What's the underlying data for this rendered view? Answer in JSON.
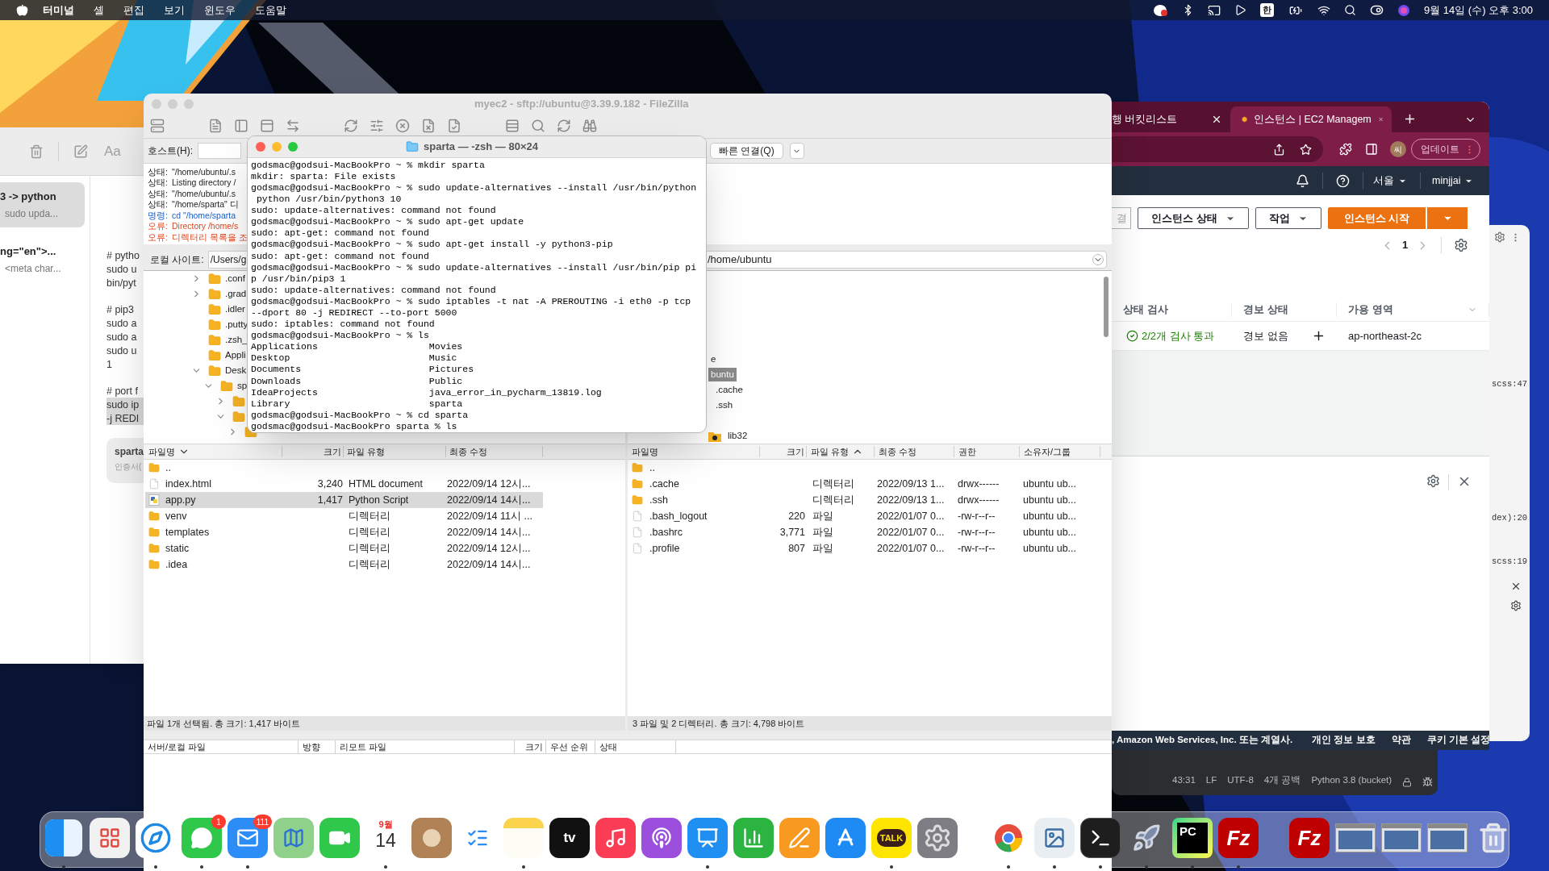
{
  "menu_bar": {
    "app": "터미널",
    "menus": [
      "셸",
      "편집",
      "보기",
      "윈도우",
      "도움말"
    ],
    "input_source": "한",
    "clock": "9월 14일 (수) 오후 3:00"
  },
  "notes_window": {
    "toolbar_text": "Aa",
    "notes": [
      {
        "title": "3 -> python",
        "preview": "sudo upda...",
        "selected": true
      },
      {
        "title": "ng=\"en\">...",
        "preview": "<meta char...",
        "selected": false
      }
    ],
    "paragraphs": [
      {
        "lines": [
          {
            "text": "# pytho",
            "highlighted": false
          },
          {
            "text": "sudo u",
            "highlighted": false
          },
          {
            "text": "bin/pyt",
            "highlighted": false
          }
        ]
      },
      {
        "lines": [
          {
            "text": "# pip3",
            "highlighted": false
          },
          {
            "text": "sudo a",
            "highlighted": false
          },
          {
            "text": "sudo a",
            "highlighted": false
          },
          {
            "text": "sudo u",
            "highlighted": false
          },
          {
            "text": "1",
            "highlighted": false
          }
        ]
      },
      {
        "lines": [
          {
            "text": "# port f",
            "highlighted": false
          },
          {
            "text": "sudo ip",
            "highlighted": true
          },
          {
            "text": "-j REDI",
            "highlighted": true
          }
        ]
      }
    ],
    "attachment": {
      "title": "sparta",
      "subtitle": "인증서("
    }
  },
  "filezilla": {
    "title": "myec2 - sftp://ubuntu@3.39.9.182 - FileZilla",
    "host_label": "호스트(H):",
    "quickconnect": "빠른 연결(Q)",
    "log": [
      {
        "kind": "status",
        "label": "상태:",
        "text": "\"/home/ubuntu/.s"
      },
      {
        "kind": "status",
        "label": "상태:",
        "text": "Listing directory /"
      },
      {
        "kind": "status",
        "label": "상태:",
        "text": "\"/home/ubuntu/.s"
      },
      {
        "kind": "status",
        "label": "상태:",
        "text": "\"/home/sparta\" 디"
      },
      {
        "kind": "command",
        "label": "명령:",
        "text": "cd \"/home/sparta"
      },
      {
        "kind": "error",
        "label": "오류:",
        "text": "Directory /home/s"
      },
      {
        "kind": "error",
        "label": "오류:",
        "text": "디렉터리 목록을 조"
      }
    ],
    "local": {
      "label": "로컬 사이트:",
      "path": "/Users/g",
      "tree": [
        {
          "label": ".conf",
          "expanded": false
        },
        {
          "label": ".grad",
          "expanded": false
        },
        {
          "label": ".idler"
        },
        {
          "label": ".putty"
        },
        {
          "label": ".zsh_"
        },
        {
          "label": "Appli"
        },
        {
          "label": "Desk",
          "expanded": true,
          "children": [
            {
              "label": "sp",
              "expanded": true,
              "children": [
                {
                  "expanded": false
                },
                {
                  "expanded": true,
                  "children": [
                    {
                      "expanded": false
                    }
                  ]
                }
              ]
            }
          ]
        }
      ],
      "columns": [
        {
          "label": "파일명",
          "kind": "sort_desc"
        },
        {
          "label": "크기",
          "kind": "plain"
        },
        {
          "label": "파일 유형",
          "kind": "plain"
        },
        {
          "label": "최종 수정",
          "kind": "plain"
        }
      ],
      "rows": [
        {
          "kind": "parent",
          "name": "..",
          "selected": false
        },
        {
          "kind": "file",
          "name": "index.html",
          "size": "3,240",
          "type": "HTML document",
          "modified": "2022/09/14 12시...",
          "selected": false
        },
        {
          "kind": "python",
          "name": "app.py",
          "size": "1,417",
          "type": "Python Script",
          "modified": "2022/09/14 14시...",
          "selected": true
        },
        {
          "kind": "folder",
          "name": "venv",
          "type": "디렉터리",
          "modified": "2022/09/14 11시 ...",
          "selected": false
        },
        {
          "kind": "folder",
          "name": "templates",
          "type": "디렉터리",
          "modified": "2022/09/14 14시...",
          "selected": false
        },
        {
          "kind": "folder",
          "name": "static",
          "type": "디렉터리",
          "modified": "2022/09/14 12시...",
          "selected": false
        },
        {
          "kind": "folder",
          "name": ".idea",
          "type": "디렉터리",
          "modified": "2022/09/14 14시...",
          "selected": false
        }
      ],
      "status": "파일 1개 선택됨. 총 크기: 1,417 바이트"
    },
    "remote": {
      "path": "/home/ubuntu",
      "tree": [
        {
          "label": "e",
          "selected": false
        },
        {
          "label": "buntu",
          "selected": true,
          "children": [
            {
              "label": ".cache",
              "selected": false
            },
            {
              "label": ".ssh",
              "selected": false
            }
          ]
        },
        {
          "label": "lib32",
          "kind": "unknown_folder",
          "selected": false
        }
      ],
      "columns": [
        {
          "label": "파일명",
          "kind": "plain"
        },
        {
          "label": "크기",
          "kind": "plain"
        },
        {
          "label": "파일 유형",
          "kind": "sort_asc"
        },
        {
          "label": "최종 수정",
          "kind": "plain"
        },
        {
          "label": "권한",
          "kind": "plain"
        },
        {
          "label": "소유자/그룹",
          "kind": "plain"
        }
      ],
      "rows": [
        {
          "kind": "parent",
          "name": "..",
          "selected": false
        },
        {
          "kind": "folder",
          "name": ".cache",
          "type": "디렉터리",
          "modified": "2022/09/13 1...",
          "permissions": "drwx------",
          "owner": "ubuntu ub...",
          "selected": false
        },
        {
          "kind": "folder",
          "name": ".ssh",
          "type": "디렉터리",
          "modified": "2022/09/13 1...",
          "permissions": "drwx------",
          "owner": "ubuntu ub...",
          "selected": false
        },
        {
          "kind": "file",
          "name": ".bash_logout",
          "size": "220",
          "type": "파일",
          "modified": "2022/01/07 0...",
          "permissions": "-rw-r--r--",
          "owner": "ubuntu ub...",
          "selected": false
        },
        {
          "kind": "file",
          "name": ".bashrc",
          "size": "3,771",
          "type": "파일",
          "modified": "2022/01/07 0...",
          "permissions": "-rw-r--r--",
          "owner": "ubuntu ub...",
          "selected": false
        },
        {
          "kind": "file",
          "name": ".profile",
          "size": "807",
          "type": "파일",
          "modified": "2022/01/07 0...",
          "permissions": "-rw-r--r--",
          "owner": "ubuntu ub...",
          "selected": false
        }
      ],
      "status": "3 파일 및 2 디렉터리. 총 크기: 4,798 바이트"
    },
    "queue_columns": [
      "서버/로컬 파일",
      "방향",
      "리모트 파일",
      "크기",
      "우선 순위",
      "상태"
    ]
  },
  "terminal": {
    "title": "sparta — -zsh — 80×24",
    "lines": [
      "godsmac@godsui-MacBookPro ~ % mkdir sparta",
      "mkdir: sparta: File exists",
      "godsmac@godsui-MacBookPro ~ % sudo update-alternatives --install /usr/bin/python",
      " python /usr/bin/python3 10",
      "sudo: update-alternatives: command not found",
      "godsmac@godsui-MacBookPro ~ % sudo apt-get update",
      "sudo: apt-get: command not found",
      "godsmac@godsui-MacBookPro ~ % sudo apt-get install -y python3-pip",
      "sudo: apt-get: command not found",
      "godsmac@godsui-MacBookPro ~ % sudo update-alternatives --install /usr/bin/pip pi",
      "p /usr/bin/pip3 1",
      "sudo: update-alternatives: command not found",
      "godsmac@godsui-MacBookPro ~ % sudo iptables -t nat -A PREROUTING -i eth0 -p tcp",
      "--dport 80 -j REDIRECT --to-port 5000",
      "sudo: iptables: command not found",
      "godsmac@godsui-MacBookPro ~ % ls",
      "Applications                    Movies",
      "Desktop                         Music",
      "Documents                       Pictures",
      "Downloads                       Public",
      "IdeaProjects                    java_error_in_pycharm_13819.log",
      "Library                         sparta",
      "godsmac@godsui-MacBookPro ~ % cd sparta",
      "godsmac@godsui-MacBookPro sparta % ls"
    ]
  },
  "browser": {
    "tabs": [
      {
        "title": "행 버킷리스트",
        "selected": false
      },
      {
        "title": "인스턴스 | EC2 Managem",
        "selected": true
      }
    ],
    "update_button": "업데이트",
    "avatar": "씨",
    "console": {
      "region": "서울",
      "user": "minjjai",
      "buttons": [
        {
          "label": "결",
          "kind": "plain"
        },
        {
          "label": "인스턴스 상태",
          "kind": "dropdown"
        },
        {
          "label": "작업",
          "kind": "dropdown"
        },
        {
          "label": "인스턴스 시작",
          "kind": "primary"
        },
        {
          "kind": "primary_caret"
        }
      ],
      "page": "1",
      "columns": [
        "상태 검사",
        "경보 상태",
        "가용 영역"
      ],
      "row": {
        "status_check": "2/2개 검사 통과",
        "alarm": "경보 없음",
        "zone": "ap-northeast-2c"
      },
      "footer": [
        ", Amazon Web Services, Inc. 또는 계열사.",
        "개인 정보 보호",
        "약관",
        "쿠키 기본 설정"
      ]
    }
  },
  "editor_window": {
    "fragments": [
      "scss:47",
      "dex):20",
      "scss:19"
    ],
    "status_bar": [
      "43:31",
      "LF",
      "UTF-8",
      "4개 공백",
      "Python 3.8 (bucket)"
    ]
  },
  "dock": [
    {
      "kind": "finder",
      "running": true
    },
    {
      "kind": "launchpad",
      "running": false
    },
    {
      "kind": "safari",
      "running": true
    },
    {
      "kind": "messages",
      "running": true,
      "badge": "1"
    },
    {
      "kind": "mail",
      "running": true,
      "badge": "111"
    },
    {
      "kind": "maps",
      "running": false
    },
    {
      "kind": "facetime",
      "running": false
    },
    {
      "kind": "calendar",
      "running": true,
      "month": "9월",
      "day": "14"
    },
    {
      "kind": "contacts",
      "running": false
    },
    {
      "kind": "reminders",
      "running": false
    },
    {
      "kind": "notes",
      "running": true
    },
    {
      "kind": "tv",
      "running": false,
      "text": "tv"
    },
    {
      "kind": "music",
      "running": false
    },
    {
      "kind": "podcasts",
      "running": false
    },
    {
      "kind": "keynote",
      "running": true
    },
    {
      "kind": "numbers",
      "running": false
    },
    {
      "kind": "pages",
      "running": false
    },
    {
      "kind": "appstore",
      "running": false
    },
    {
      "kind": "kakaotalk",
      "running": true,
      "text": "TALK"
    },
    {
      "kind": "settings",
      "running": false
    },
    {
      "kind": "divider"
    },
    {
      "kind": "chrome",
      "running": true
    },
    {
      "kind": "preview",
      "running": true
    },
    {
      "kind": "terminal",
      "running": true
    },
    {
      "kind": "rocket",
      "running": true
    },
    {
      "kind": "pycharm",
      "running": true,
      "text": "PC"
    },
    {
      "kind": "filezilla",
      "running": true,
      "text": "Fz"
    },
    {
      "kind": "divider"
    },
    {
      "kind": "filezilla",
      "running": false,
      "text": "Fz"
    },
    {
      "kind": "window",
      "running": false
    },
    {
      "kind": "window",
      "running": false
    },
    {
      "kind": "window",
      "running": false
    },
    {
      "kind": "trash",
      "running": false
    }
  ]
}
